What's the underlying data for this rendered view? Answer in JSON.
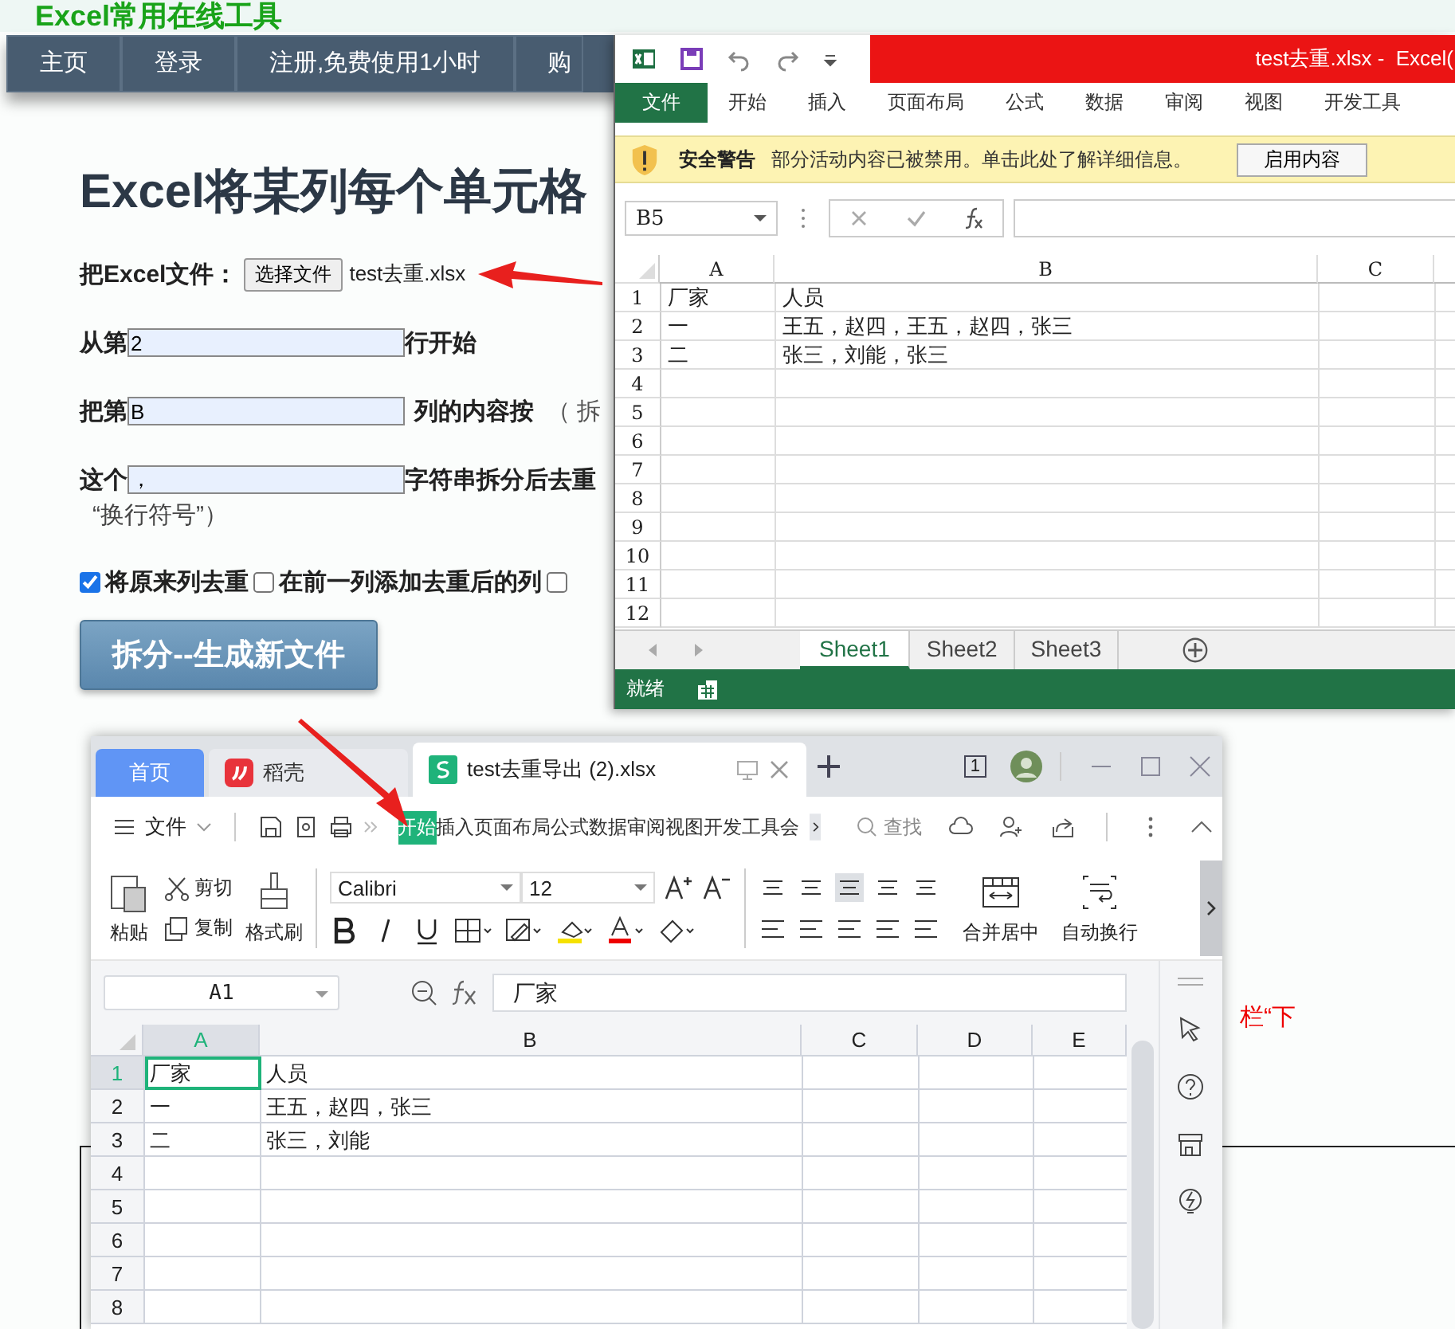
{
  "site_header": {
    "title": "Excel常用在线工具"
  },
  "nav": {
    "items": [
      "主页",
      "登录",
      "注册,免费使用1小时",
      "购"
    ]
  },
  "heading": "Excel将某列每个单元格",
  "form": {
    "file_label": "把Excel文件：",
    "file_button": "选择文件",
    "file_name": "test去重.xlsx",
    "start_row": {
      "before": "从第",
      "value": "2",
      "after": "行开始"
    },
    "column": {
      "before": "把第",
      "value": "B",
      "after": "列的内容按",
      "note": "（ 拆"
    },
    "separator": {
      "before": "这个",
      "value": "，",
      "after": "字符串拆分后去重",
      "note": "“换行符号”）"
    },
    "options": [
      {
        "label": "将原来列去重",
        "checked": true
      },
      {
        "label": "在前一列添加去重后的列",
        "checked": false
      },
      {
        "checked": false
      }
    ],
    "submit": "拆分--生成新文件"
  },
  "page_note": "栏“下",
  "excel": {
    "title": "test去重.xlsx -  Excel(",
    "tabs": [
      {
        "label": "文件",
        "selected": true
      },
      {
        "label": "开始",
        "selected": false
      },
      {
        "label": "插入",
        "selected": false
      },
      {
        "label": "页面布局",
        "selected": false
      },
      {
        "label": "公式",
        "selected": false
      },
      {
        "label": "数据",
        "selected": false
      },
      {
        "label": "审阅",
        "selected": false
      },
      {
        "label": "视图",
        "selected": false
      },
      {
        "label": "开发工具",
        "selected": false
      }
    ],
    "security_bar": {
      "title": "安全警告",
      "message": "部分活动内容已被禁用。单击此处了解详细信息。",
      "button": "启用内容"
    },
    "name_box": "B5",
    "columns": [
      "A",
      "B",
      "C"
    ],
    "rows": [
      {
        "num": "1",
        "cells": [
          "厂家",
          "人员"
        ]
      },
      {
        "num": "2",
        "cells": [
          "一",
          "王五，赵四，王五，赵四，张三"
        ]
      },
      {
        "num": "3",
        "cells": [
          "二",
          "张三，刘能，张三"
        ]
      },
      {
        "num": "4"
      },
      {
        "num": "5"
      },
      {
        "num": "6"
      },
      {
        "num": "7"
      },
      {
        "num": "8"
      },
      {
        "num": "9"
      },
      {
        "num": "10"
      },
      {
        "num": "11"
      },
      {
        "num": "12"
      }
    ],
    "sheets": [
      {
        "label": "Sheet1",
        "selected": true
      },
      {
        "label": "Sheet2",
        "selected": false
      },
      {
        "label": "Sheet3",
        "selected": false
      }
    ],
    "status": "就绪"
  },
  "wps": {
    "tabs": [
      {
        "label": "首页",
        "kind": "home",
        "selected": false
      },
      {
        "label": "稻壳",
        "kind": "app",
        "selected": false
      },
      {
        "label": "test去重导出 (2).xlsx",
        "kind": "file",
        "selected": true
      }
    ],
    "window_count": "1",
    "file_menu": "文件",
    "ribbon_tabs": [
      {
        "label": "开始",
        "selected": true
      },
      {
        "label": "插入",
        "selected": false
      },
      {
        "label": "页面布局",
        "selected": false
      },
      {
        "label": "公式",
        "selected": false
      },
      {
        "label": "数据",
        "selected": false
      },
      {
        "label": "审阅",
        "selected": false
      },
      {
        "label": "视图",
        "selected": false
      },
      {
        "label": "开发工具",
        "selected": false
      },
      {
        "label": "会",
        "selected": false
      }
    ],
    "search": {
      "placeholder": "查找"
    },
    "toolbar": {
      "paste": "粘贴",
      "cut": "剪切",
      "copy": "复制",
      "format_painter": "格式刷",
      "font": "Calibri",
      "size": "12",
      "merge": "合并居中",
      "wrap": "自动换行"
    },
    "name_box": "A1",
    "formula": "厂家",
    "columns": [
      {
        "label": "A",
        "selected": true
      },
      {
        "label": "B",
        "selected": false
      },
      {
        "label": "C",
        "selected": false
      },
      {
        "label": "D",
        "selected": false
      },
      {
        "label": "E",
        "selected": false
      }
    ],
    "rows": [
      {
        "num": "1",
        "selected": true,
        "cells": [
          "厂家",
          "人员"
        ]
      },
      {
        "num": "2",
        "selected": false,
        "cells": [
          "一",
          "王五，赵四，张三"
        ]
      },
      {
        "num": "3",
        "selected": false,
        "cells": [
          "二",
          "张三，刘能"
        ]
      },
      {
        "num": "4",
        "selected": false
      },
      {
        "num": "5",
        "selected": false
      },
      {
        "num": "6",
        "selected": false
      },
      {
        "num": "7",
        "selected": false
      },
      {
        "num": "8",
        "selected": false
      }
    ]
  }
}
